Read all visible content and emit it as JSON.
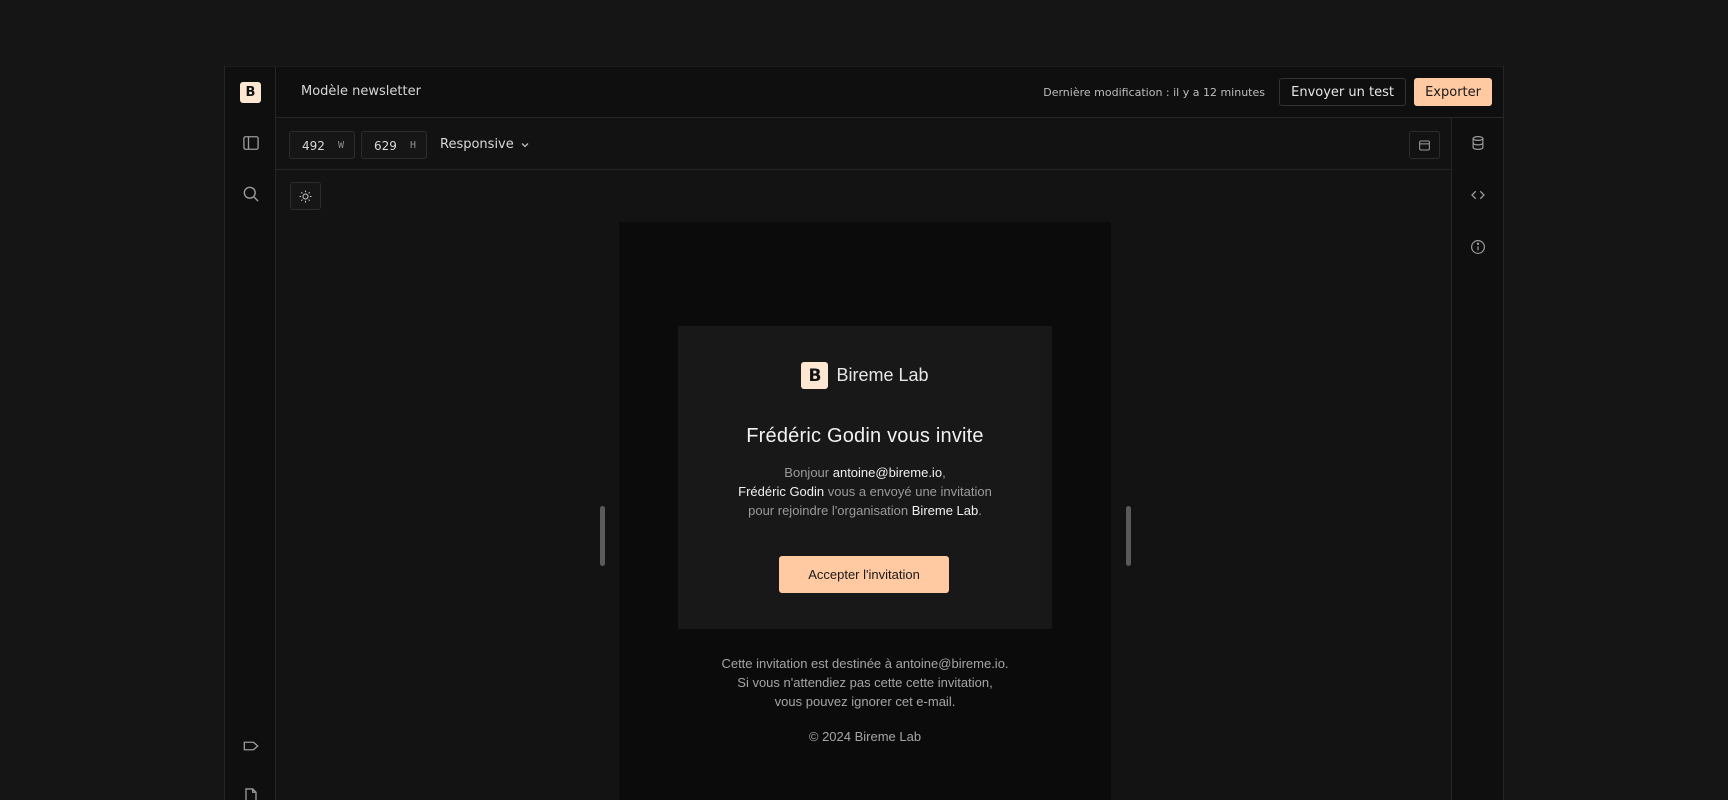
{
  "app": {
    "logo_letter": "B"
  },
  "header": {
    "title": "Modèle newsletter",
    "last_modified_label": "Dernière modification :",
    "last_modified_value": "il y a 12 minutes",
    "send_test_label": "Envoyer un test",
    "export_label": "Exporter",
    "accent_color": "#ffc9a2"
  },
  "toolbar": {
    "width_value": "492",
    "width_unit": "W",
    "height_value": "629",
    "height_unit": "H",
    "mode_label": "Responsive"
  },
  "sidebar_left": {
    "icons": [
      "sidebar-toggle-icon",
      "search-icon",
      "tag-icon",
      "file-icon"
    ]
  },
  "sidebar_right": {
    "icons": [
      "database-icon",
      "code-icon",
      "info-icon"
    ]
  },
  "email": {
    "brand_letter": "B",
    "brand_name": "Bireme Lab",
    "heading": "Frédéric Godin vous invite",
    "greeting_prefix": "Bonjour",
    "recipient": "antoine@bireme.io",
    "greeting_suffix": ",",
    "inviter": "Frédéric Godin",
    "invite_text": "vous a envoyé une invitation",
    "join_text": "pour rejoindre l'organisation",
    "org": "Bireme Lab",
    "period": ".",
    "cta_label": "Accepter l'invitation",
    "footer_line1": "Cette invitation est destinée à antoine@bireme.io.",
    "footer_line2": "Si vous n'attendiez pas cette cette invitation,",
    "footer_line3": "vous pouvez ignorer cet e-mail.",
    "copyright": "© 2024 Bireme Lab"
  }
}
